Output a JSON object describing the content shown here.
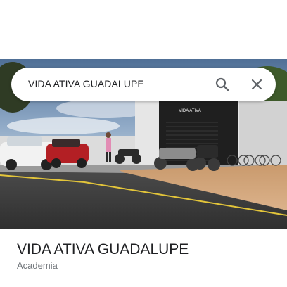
{
  "search": {
    "query": "VIDA ATIVA GUADALUPE",
    "search_icon": "search-icon",
    "close_icon": "close-icon"
  },
  "hero": {
    "image": "place-photo",
    "storefront_sign": "VIDA ATIVA"
  },
  "place": {
    "name": "VIDA ATIVA GUADALUPE",
    "category": "Academia"
  },
  "colors": {
    "text_primary": "#202124",
    "text_secondary": "#70757a",
    "icon": "#5f6368"
  }
}
